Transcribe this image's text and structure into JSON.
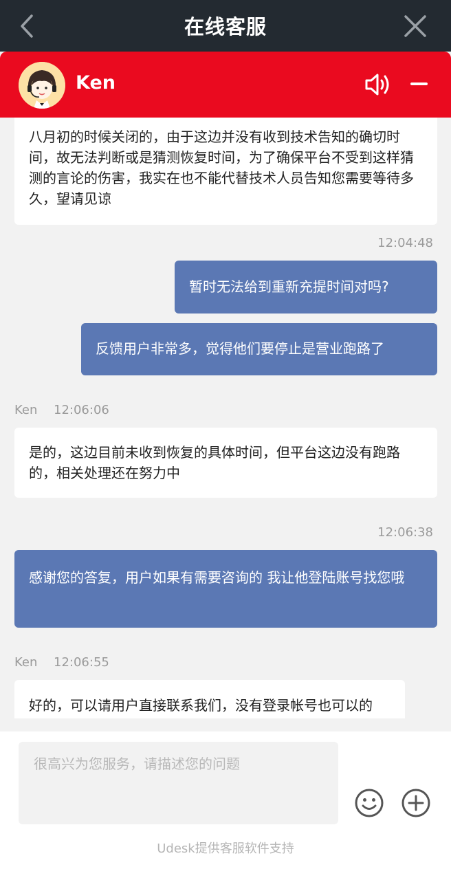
{
  "header": {
    "title": "在线客服",
    "back_icon": "chevron-left-icon",
    "close_icon": "close-icon"
  },
  "agent_bar": {
    "name": "Ken",
    "avatar": "customer-service-avatar",
    "sound_icon": "speaker-icon",
    "minimize_icon": "minimize-icon",
    "color": "#ea0a1f"
  },
  "messages": [
    {
      "from": "agent",
      "text": "八月初的时候关闭的，由于这边并没有收到技术告知的确切时间，故无法判断或是猜测恢复时间，为了确保平台不受到这样猜测的言论的伤害，我实在也不能代替技术人员告知您需要等待多久，望请见谅"
    },
    {
      "from": "user",
      "time": "12:04:48",
      "text": "暂时无法给到重新充提时间对吗?"
    },
    {
      "from": "user",
      "text": "反馈用户非常多，觉得他们要停止是营业跑路了"
    },
    {
      "from": "agent",
      "sender": "Ken",
      "time": "12:06:06",
      "text": "是的，这边目前未收到恢复的具体时间，但平台这边没有跑路的，相关处理还在努力中"
    },
    {
      "from": "user",
      "time": "12:06:38",
      "text": "感谢您的答复，用户如果有需要咨询的 我让他登陆账号找您哦"
    },
    {
      "from": "agent",
      "sender": "Ken",
      "time": "12:06:55",
      "text": "好的，可以请用户直接联系我们，没有登录帐号也可以的"
    }
  ],
  "composer": {
    "placeholder": "很高兴为您服务，请描述您的问题",
    "value": "",
    "emoji_icon": "emoji-icon",
    "plus_icon": "plus-icon"
  },
  "footer_text": "Udesk提供客服软件支持",
  "colors": {
    "title_bar": "#232a31",
    "user_bubble": "#5b78b4",
    "agent_bubble": "#ffffff",
    "background": "#f2f2f2"
  }
}
